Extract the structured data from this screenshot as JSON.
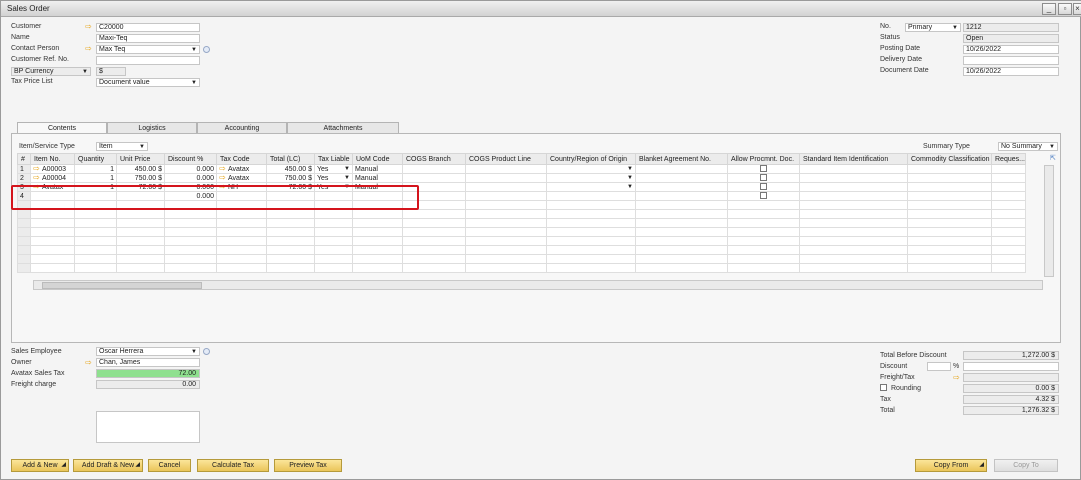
{
  "window": {
    "title": "Sales Order"
  },
  "header_left": {
    "customer_label": "Customer",
    "customer_value": "C20000",
    "name_label": "Name",
    "name_value": "Maxi-Teq",
    "contact_label": "Contact Person",
    "contact_value": "Max Teq",
    "ref_label": "Customer Ref. No.",
    "ref_value": "",
    "currency_label": "BP Currency",
    "currency_value": "$",
    "taxprice_label": "Tax Price List",
    "taxprice_value": "Document value"
  },
  "header_right": {
    "no_label": "No.",
    "no_series": "Primary",
    "no_value": "1212",
    "status_label": "Status",
    "status_value": "Open",
    "posting_label": "Posting Date",
    "posting_value": "10/26/2022",
    "delivery_label": "Delivery Date",
    "delivery_value": "",
    "document_label": "Document Date",
    "document_value": "10/26/2022"
  },
  "tabs": [
    "Contents",
    "Logistics",
    "Accounting",
    "Attachments"
  ],
  "contents": {
    "item_type_label": "Item/Service Type",
    "item_type_value": "Item",
    "summary_label": "Summary Type",
    "summary_value": "No Summary",
    "columns": [
      "#",
      "Item No.",
      "Quantity",
      "Unit Price",
      "Discount %",
      "Tax Code",
      "Total (LC)",
      "Tax Liable",
      "UoM Code",
      "COGS Branch",
      "COGS Product Line",
      "Country/Region of Origin",
      "Blanket Agreement No.",
      "Allow Procmnt. Doc.",
      "Standard Item Identification",
      "Commodity Classification",
      "Reques..."
    ],
    "rows": [
      {
        "n": "1",
        "item": "A00003",
        "qty": "1",
        "price": "450.00 $",
        "disc": "0.000",
        "tax": "Avatax",
        "total": "450.00 $",
        "liable": "Yes",
        "uom": "Manual"
      },
      {
        "n": "2",
        "item": "A00004",
        "qty": "1",
        "price": "750.00 $",
        "disc": "0.000",
        "tax": "Avatax",
        "total": "750.00 $",
        "liable": "Yes",
        "uom": "Manual"
      },
      {
        "n": "3",
        "item": "Avatax",
        "qty": "1",
        "price": "72.00 $",
        "disc": "0.000",
        "tax": "NH",
        "total": "72.00 $",
        "liable": "Yes",
        "uom": "Manual"
      },
      {
        "n": "4",
        "item": "",
        "qty": "",
        "price": "",
        "disc": "0.000",
        "tax": "",
        "total": "",
        "liable": "",
        "uom": ""
      }
    ]
  },
  "footer_left": {
    "employee_label": "Sales Employee",
    "employee_value": "Oscar Herrera",
    "owner_label": "Owner",
    "owner_value": "Chan, James",
    "avatax_label": "Avatax Sales Tax",
    "avatax_value": "72.00",
    "freight_label": "Freight charge",
    "freight_value": "0.00"
  },
  "totals": {
    "before_label": "Total Before Discount",
    "before_value": "1,272.00 $",
    "discount_label": "Discount",
    "discount_pct": "%",
    "discount_value": "",
    "freight_label": "Freight/Tax",
    "freight_value": "",
    "rounding_label": "Rounding",
    "rounding_value": "0.00 $",
    "tax_label": "Tax",
    "tax_value": "4.32 $",
    "total_label": "Total",
    "total_value": "1,276.32 $"
  },
  "buttons": {
    "add_new": "Add & New",
    "add_draft": "Add Draft & New",
    "cancel": "Cancel",
    "calc_tax": "Calculate Tax",
    "preview_tax": "Preview Tax",
    "copy_from": "Copy From",
    "copy_to": "Copy To"
  },
  "colors": {
    "button": "#eac55a",
    "highlight": "#d4141c",
    "avatax": "#8fe08f"
  }
}
